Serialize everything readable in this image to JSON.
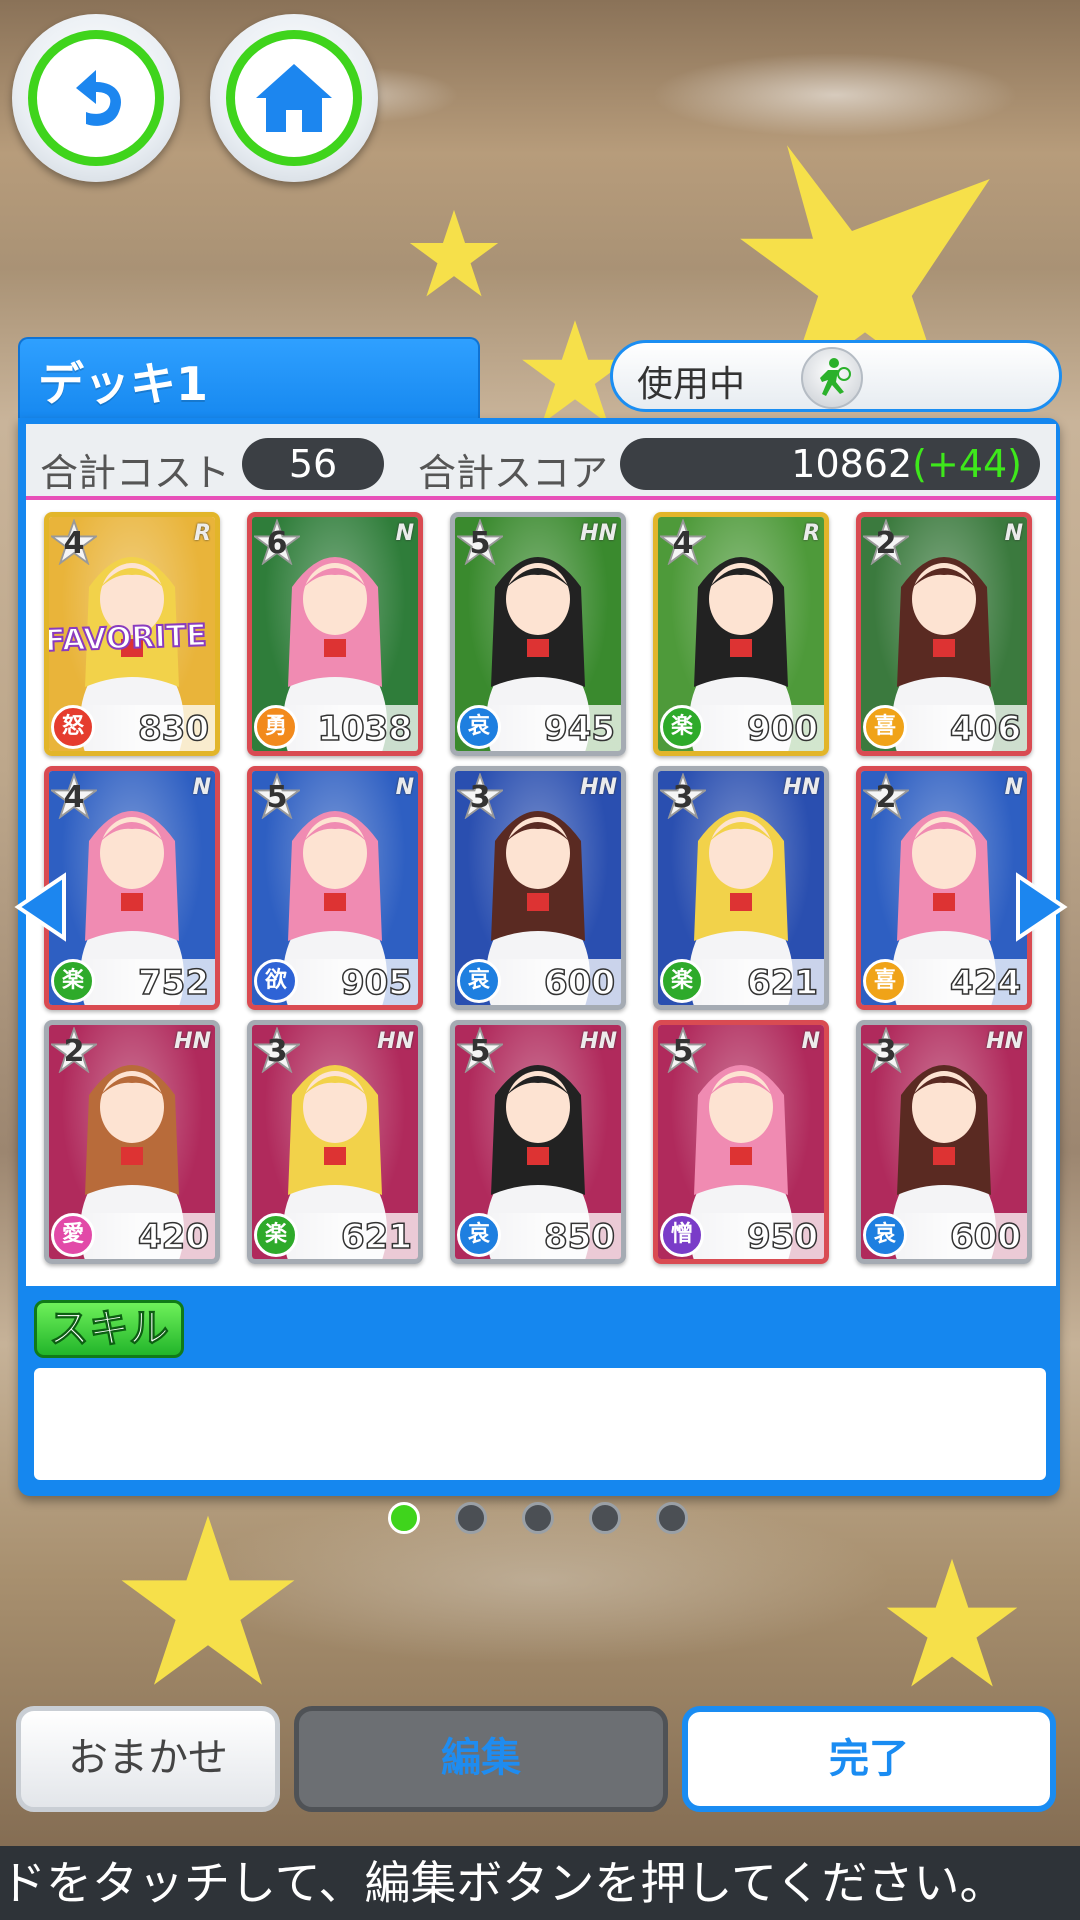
{
  "deck": {
    "title": "デッキ1",
    "status_label": "使用中",
    "total_cost_label": "合計コスト",
    "total_cost": "56",
    "total_score_label": "合計スコア",
    "total_score": "10862",
    "score_bonus": "(+44)"
  },
  "cards": [
    {
      "cost": "4",
      "rarity": "R",
      "emotion": "怒",
      "emotion_color": "#e53c2e",
      "score": "830",
      "favorite": "FAVORITE",
      "bg": "#e9b43a"
    },
    {
      "cost": "6",
      "rarity": "N",
      "emotion": "勇",
      "emotion_color": "#f28a1c",
      "score": "1038",
      "bg": "#2f7d3a"
    },
    {
      "cost": "5",
      "rarity": "HN",
      "emotion": "哀",
      "emotion_color": "#1e7fe0",
      "score": "945",
      "bg": "#3a8a2e"
    },
    {
      "cost": "4",
      "rarity": "R",
      "emotion": "楽",
      "emotion_color": "#2eaa2a",
      "score": "900",
      "bg": "#4e9a3a"
    },
    {
      "cost": "2",
      "rarity": "N",
      "emotion": "喜",
      "emotion_color": "#f0a318",
      "score": "406",
      "bg": "#3b7a3e"
    },
    {
      "cost": "4",
      "rarity": "N",
      "emotion": "楽",
      "emotion_color": "#2eaa2a",
      "score": "752",
      "bg": "#2e5fc2"
    },
    {
      "cost": "5",
      "rarity": "N",
      "emotion": "欲",
      "emotion_color": "#2e63d6",
      "score": "905",
      "bg": "#2e5fc2"
    },
    {
      "cost": "3",
      "rarity": "HN",
      "emotion": "哀",
      "emotion_color": "#1e7fe0",
      "score": "600",
      "bg": "#2a4fb0"
    },
    {
      "cost": "3",
      "rarity": "HN",
      "emotion": "楽",
      "emotion_color": "#2eaa2a",
      "score": "621",
      "bg": "#2a4fb0"
    },
    {
      "cost": "2",
      "rarity": "N",
      "emotion": "喜",
      "emotion_color": "#f0a318",
      "score": "424",
      "bg": "#2e5fc2"
    },
    {
      "cost": "2",
      "rarity": "HN",
      "emotion": "愛",
      "emotion_color": "#e24aa8",
      "score": "420",
      "bg": "#b02a5c"
    },
    {
      "cost": "3",
      "rarity": "HN",
      "emotion": "楽",
      "emotion_color": "#2eaa2a",
      "score": "621",
      "bg": "#b02a5c"
    },
    {
      "cost": "5",
      "rarity": "HN",
      "emotion": "哀",
      "emotion_color": "#1e7fe0",
      "score": "850",
      "bg": "#b02a5c"
    },
    {
      "cost": "5",
      "rarity": "N",
      "emotion": "憎",
      "emotion_color": "#7a3cc8",
      "score": "950",
      "bg": "#b02a5c"
    },
    {
      "cost": "3",
      "rarity": "HN",
      "emotion": "哀",
      "emotion_color": "#1e7fe0",
      "score": "600",
      "bg": "#b02a5c"
    }
  ],
  "skill": {
    "label": "スキル",
    "description": ""
  },
  "pagination": {
    "total": 5,
    "current": 1
  },
  "buttons": {
    "auto_label": "おまかせ",
    "edit_label": "編集",
    "done_label": "完了"
  },
  "instruction": "ドをタッチして、編集ボタンを押してください。",
  "icons": {
    "back": "back-arrow-icon",
    "home": "home-icon",
    "in_use": "running-person-icon",
    "prev": "left-arrow-icon",
    "next": "right-arrow-icon"
  },
  "colors": {
    "accent_blue": "#1587ef",
    "accent_green": "#3fd41c",
    "favorite_pink": "#e74fb8"
  }
}
